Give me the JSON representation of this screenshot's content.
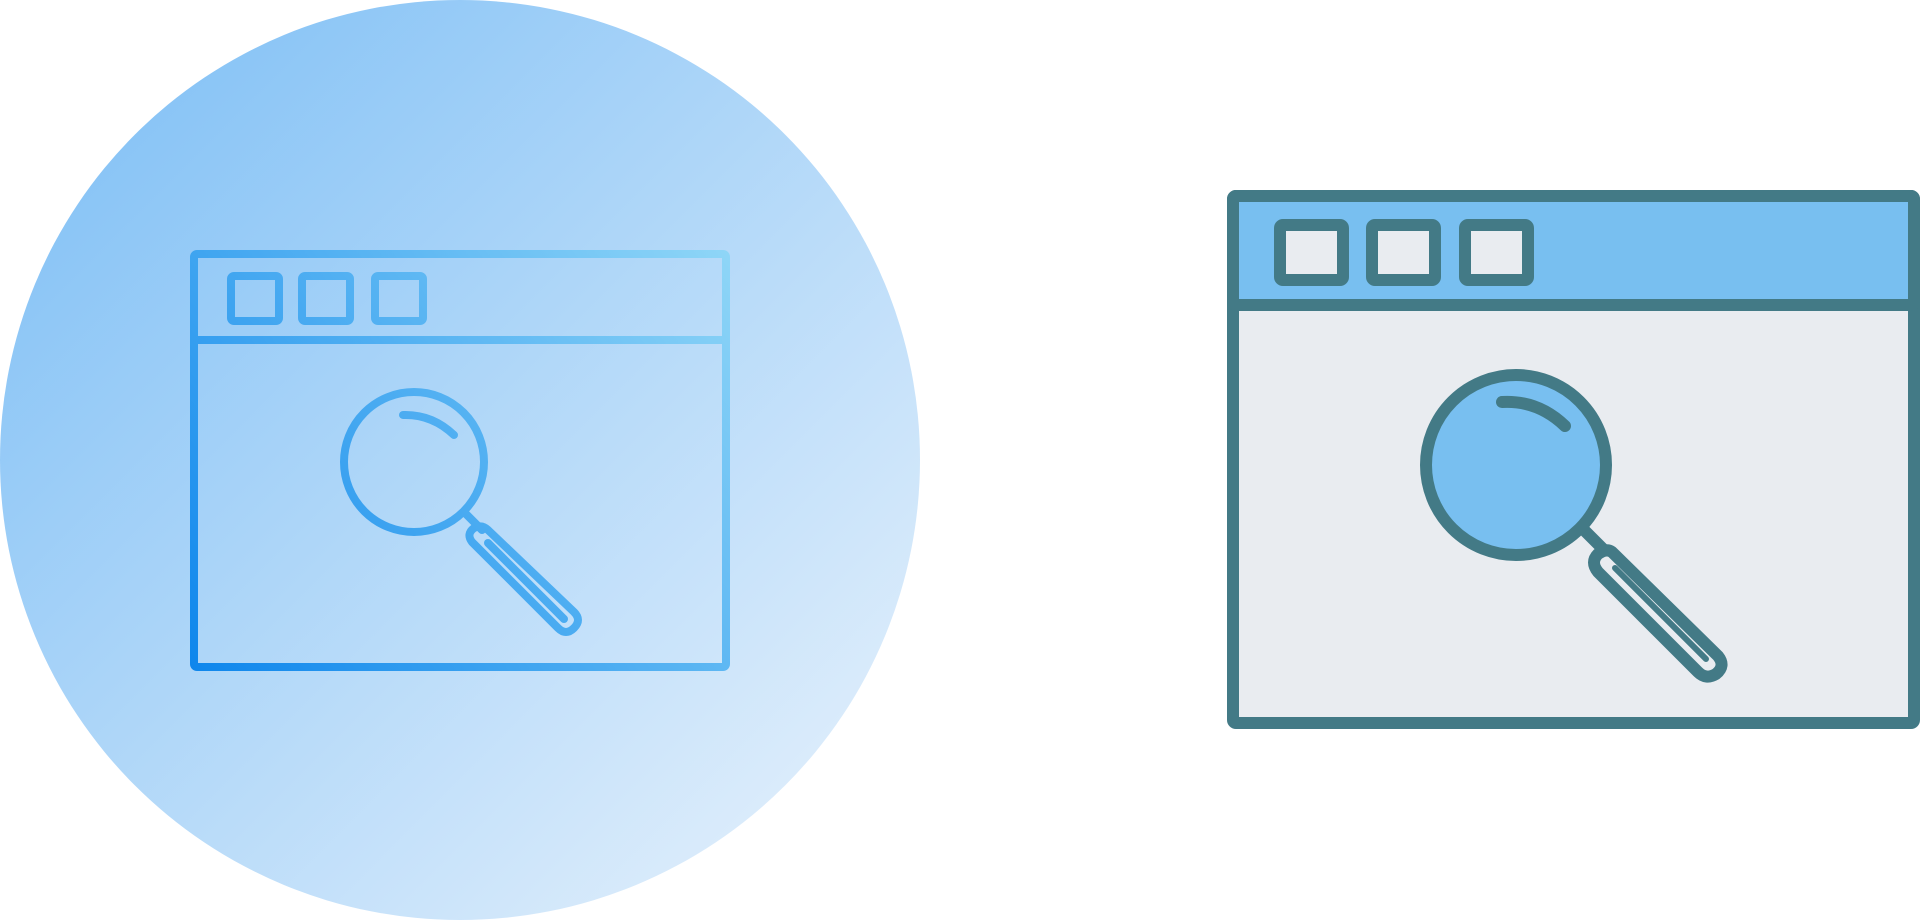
{
  "icon_pair": {
    "subject": "browser-window-search",
    "variants": [
      {
        "style": "gradient-outline",
        "background": "circle",
        "colors": {
          "circle_start": "#7ABDF5",
          "circle_end": "#EAF3FC",
          "stroke_start": "#0E86EC",
          "stroke_end": "#8FD6F7"
        }
      },
      {
        "style": "filled-outline",
        "background": "none",
        "colors": {
          "stroke": "#437A86",
          "header_fill": "#78BFF0",
          "body_fill": "#E9ECF0",
          "lens_fill": "#78BFF0"
        }
      }
    ]
  }
}
